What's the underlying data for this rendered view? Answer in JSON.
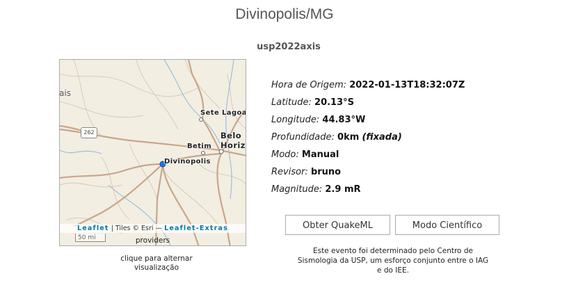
{
  "page": {
    "title": "Divinopolis/MG",
    "subtitle": "usp2022axis"
  },
  "map": {
    "cities": {
      "sete_lagoas": "Sete Lagoas",
      "belo": "Belo",
      "horizonte": "Horizo",
      "betim": "Betim",
      "divinopolis": "Divinopolis"
    },
    "left_fragment": "ais",
    "highway_shield": "262",
    "scale_label": "50 mi",
    "attribution": {
      "leaflet": "Leaflet",
      "tiles": " | Tiles © Esri — ",
      "extras": "Leaflet-Extras"
    },
    "providers": "providers",
    "colors": {
      "land": "#f2eee2",
      "major_road": "#c9a68a",
      "minor_road": "#d8cbbb",
      "river": "#9cc0dc",
      "epicenter": "#1a73e8"
    }
  },
  "caption": {
    "line1": "clique para alternar",
    "line2": "visualização"
  },
  "info": {
    "origin_label": "Hora de Origem:",
    "origin_value": "2022-01-13T18:32:07Z",
    "lat_label": "Latitude:",
    "lat_value": "20.13°S",
    "lon_label": "Longitude:",
    "lon_value": "44.83°W",
    "depth_label": "Profundidade:",
    "depth_value": "0km",
    "depth_note": "(fixada)",
    "mode_label": "Modo:",
    "mode_value": "Manual",
    "reviewer_label": "Revisor:",
    "reviewer_value": "bruno",
    "mag_label": "Magnitude:",
    "mag_value": "2.9 mR"
  },
  "buttons": {
    "quakeml": "Obter QuakeML",
    "scientific": "Modo Científico"
  },
  "footer": {
    "line1": "Este evento foi determinado pelo Centro de",
    "line2": "Sismologia da USP, um esforço conjunto entre o IAG",
    "line3": "e do IEE."
  }
}
